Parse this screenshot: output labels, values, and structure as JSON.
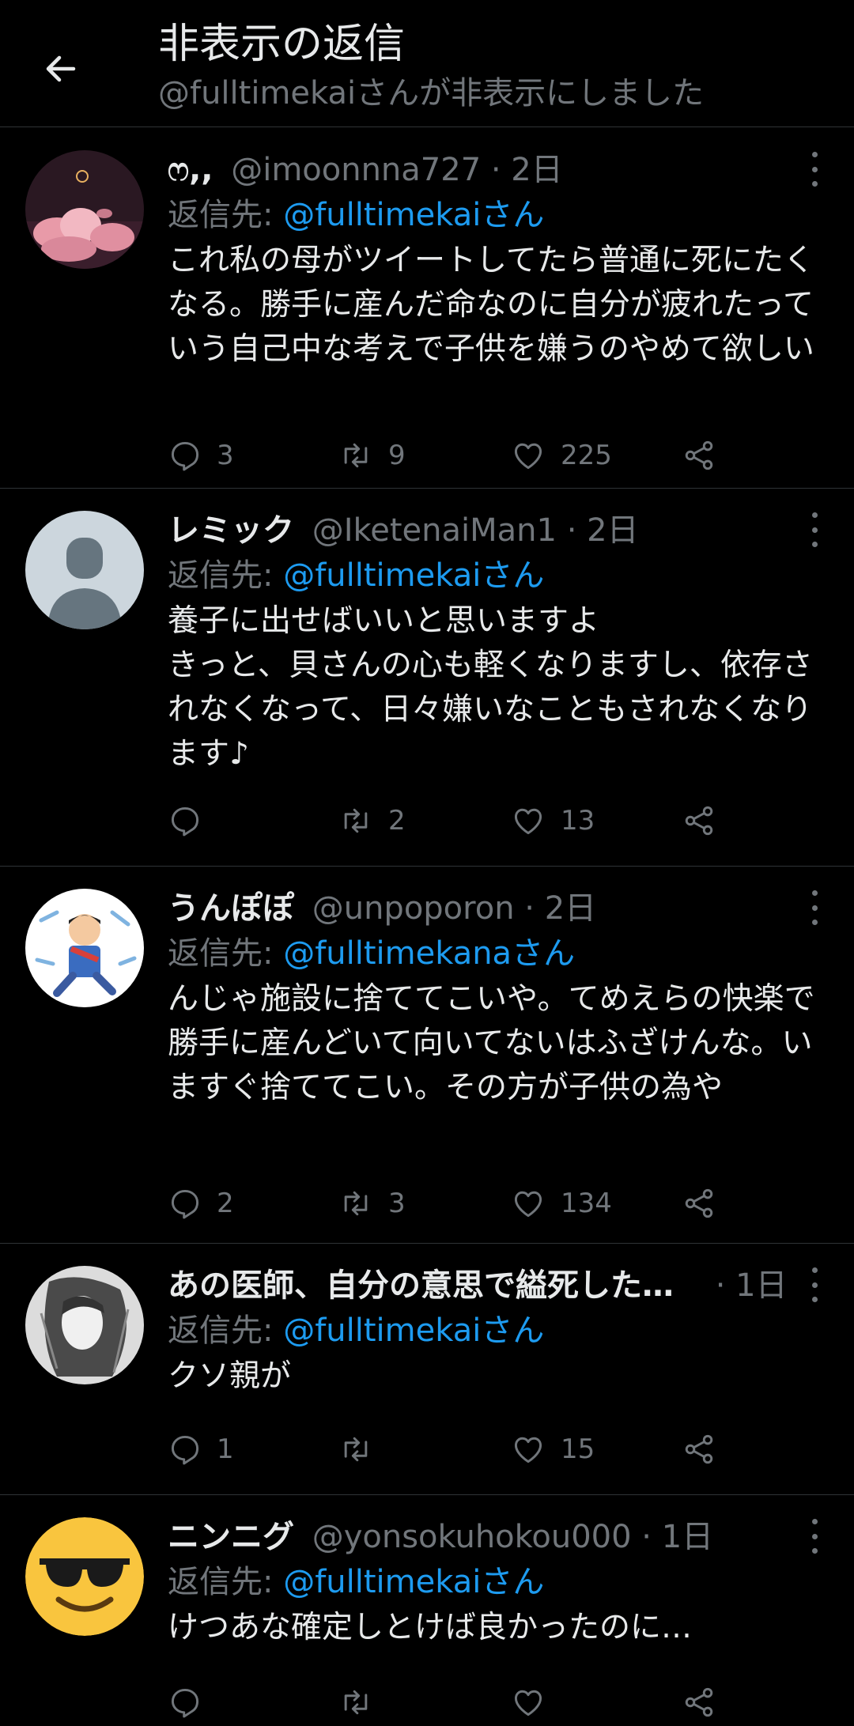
{
  "header": {
    "title": "非表示の返信",
    "subtitle": "@fulltimekaiさんが非表示にしました"
  },
  "reply_prefix": "返信先: ",
  "tweets": [
    {
      "name": "ෆ,,",
      "handle": "@imoonnna727",
      "time": "· 2日",
      "reply_to": "@fulltimekaiさん",
      "body": "これ私の母がツイートしてたら普通に死にたくなる。勝手に産んだ命なのに自分が疲れたっていう自己中な考えで子供を嫌うのやめて欲しい",
      "replies": "3",
      "retweets": "9",
      "likes": "225"
    },
    {
      "name": "レミック",
      "handle": "@IketenaiMan1",
      "time": "· 2日",
      "reply_to": "@fulltimekaiさん",
      "body": "養子に出せばいいと思いますよ\nきっと、貝さんの心も軽くなりますし、依存されなくなって、日々嫌いなこともされなくなります♪",
      "replies": "",
      "retweets": "2",
      "likes": "13"
    },
    {
      "name": "うんぽぽ",
      "handle": "@unpoporon",
      "time": "· 2日",
      "reply_to": "@fulltimekanaさん",
      "body": "んじゃ施設に捨ててこいや。てめえらの快楽で勝手に産んどいて向いてないはふざけんな。いますぐ捨ててこい。その方が子供の為や",
      "replies": "2",
      "retweets": "3",
      "likes": "134"
    },
    {
      "name": "あの医師、自分の意思で縊死した…",
      "handle": "",
      "time": "· 1日",
      "reply_to": "@fulltimekaiさん",
      "body": "クソ親が",
      "replies": "1",
      "retweets": "",
      "likes": "15"
    },
    {
      "name": "ニンニグ",
      "handle": "@yonsokuhokou000",
      "time": "· 1日",
      "reply_to": "@fulltimekaiさん",
      "body": "けつあな確定しとけば良かったのに…",
      "replies": "",
      "retweets": "",
      "likes": ""
    }
  ],
  "colors": {
    "background": "#000000",
    "text": "#e7e9ea",
    "muted": "#71767b",
    "link": "#1d9bf0",
    "divider": "#2f3336"
  }
}
